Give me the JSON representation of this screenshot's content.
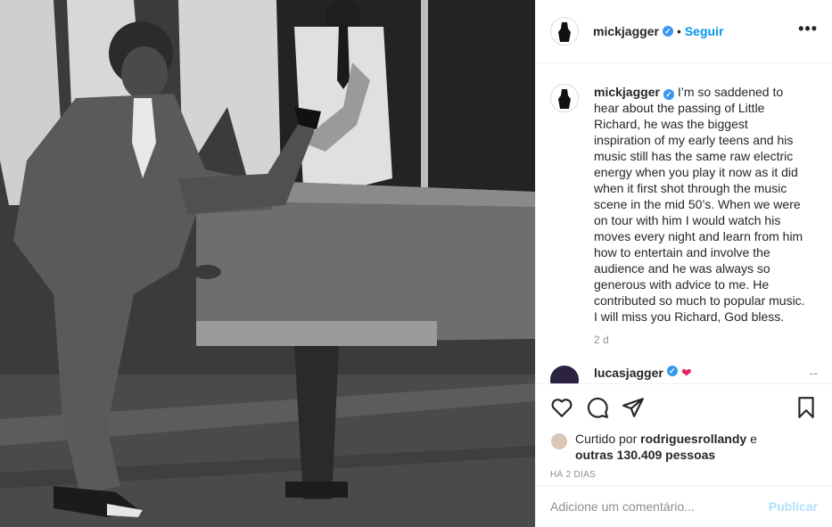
{
  "post": {
    "image_alt": "Black-and-white photo of Little Richard playing a grand piano with one leg raised, band with saxophone behind",
    "author": "mickjagger",
    "follow_label": "Seguir",
    "dot": "•",
    "more_label": "•••",
    "caption_text": "I’m so saddened to hear about the passing of Little Richard, he was the biggest inspiration of my early teens and his music still has the same raw electric energy when you play it now as it did when it first shot through the music scene in the mid 50’s. When we were on tour with him I would watch his moves every night and learn from him how to entertain and involve the audience and he was always so generous with advice to me. He contributed so much to popular music. I will miss you Richard, God bless.",
    "caption_age": "2 d",
    "reply_user": "lucasjagger",
    "reply_emoji": "❤️",
    "reply_dash": "--",
    "likes_prefix": "Curtido por",
    "likes_user": "rodriguesrollandy",
    "likes_mid": "e",
    "likes_others": "outras 130.409 pessoas",
    "posted_ago": "HÁ 2 DIAS",
    "comment_placeholder": "Adicione um comentário...",
    "publish_label": "Publicar"
  },
  "icons": {
    "like": "heart-icon",
    "comment": "comment-icon",
    "share": "share-icon",
    "save": "bookmark-icon",
    "verified": "verified-badge-icon"
  },
  "colors": {
    "accent": "#0095f6",
    "verified": "#3897f0",
    "publish_disabled": "#b2dffc",
    "muted": "#8e8e8e"
  }
}
